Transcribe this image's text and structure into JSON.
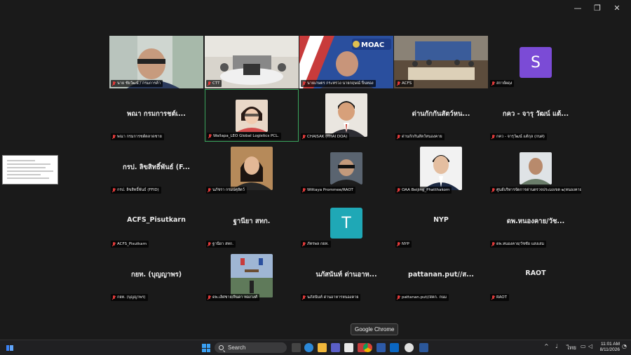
{
  "window": {
    "minimize": "—",
    "restore": "❐",
    "close": "✕"
  },
  "tiles": [
    {
      "id": "t1",
      "type": "video",
      "label": "นาย ชัยวัฒน์ / กรมการค้า"
    },
    {
      "id": "t2",
      "type": "video",
      "label": "CTT"
    },
    {
      "id": "t3",
      "type": "video",
      "label": "นายเกษตร กระทรวง นายกฤษณ์ ปิ่นทอง",
      "logo_text": "MOAC"
    },
    {
      "id": "t4",
      "type": "video",
      "label": "ACFS"
    },
    {
      "id": "t5",
      "type": "avatar",
      "letter": "S",
      "color": "#7b4bd6",
      "label": "สกาย์ผดุง"
    },
    {
      "id": "t6",
      "type": "name",
      "big": "พณา กรมการชต์เ...",
      "label": "พณา กรมการชต์ตลาดชาย"
    },
    {
      "id": "t7",
      "type": "photo",
      "label": "Wallapa_LEO Global Logistics PCL.",
      "active": true
    },
    {
      "id": "t8",
      "type": "photo",
      "label": "CHAISAK (THAI DOA)"
    },
    {
      "id": "t9",
      "type": "name",
      "big": "ด่านกักกันสัตว์หน...",
      "label": "ด่านกักกันสัตว์หนองคาย"
    },
    {
      "id": "t10",
      "type": "name",
      "big": "กคว - จารุ วัฒน์ แต้...",
      "label": "กคว - จารุวัฒน์ แต้กุล (กนศ)"
    },
    {
      "id": "t11",
      "type": "name",
      "big": "กรป. ลิขสิทธิ์พันธ์ (F...",
      "label": "กรป. ลิขสิทธิ์พันธ์ (FFID)"
    },
    {
      "id": "t12",
      "type": "photo",
      "label": "นภัชรา กรมปศุสัตว์"
    },
    {
      "id": "t13",
      "type": "photo",
      "label": "Wittaya Prommee/RAOT"
    },
    {
      "id": "t14",
      "type": "photo",
      "label": "OAA Beijing_Phatthakorn"
    },
    {
      "id": "t15",
      "type": "photo",
      "label": "ศูนย์บริหารจัดการด่านตรวจประมงเขต ๒(หนองคาย)..."
    },
    {
      "id": "t16",
      "type": "name",
      "big": "ACFS_Pisutkarn",
      "label": "ACFS_Pisutkarn"
    },
    {
      "id": "t17",
      "type": "name",
      "big": "ฐานียา สทก.",
      "label": "ฐานียา สทก."
    },
    {
      "id": "t18",
      "type": "avatar",
      "letter": "T",
      "color": "#1fa8b6",
      "label": "ภัทรพล กยท."
    },
    {
      "id": "t19",
      "type": "name",
      "big": "NYP",
      "label": "NYP"
    },
    {
      "id": "t20",
      "type": "name",
      "big": "ดพ.หนองคาย/วัช...",
      "label": "ดพ.หนองคาย/วัชชัย แสงเสม"
    },
    {
      "id": "t21",
      "type": "name",
      "big": "กยท. (บุญญาพร)",
      "label": "กยท. (บุญญาพร)"
    },
    {
      "id": "t22",
      "type": "photo",
      "label": "ดพ.เลิศชาย/ลินดา ทองวงศ์"
    },
    {
      "id": "t23",
      "type": "name",
      "big": "นภัสนันท์ ด่านอาห...",
      "label": "นภัสนันท์ ด่านอาหารหนองคาย"
    },
    {
      "id": "t24",
      "type": "name",
      "big": "pattanan.put//ส...",
      "label": "pattanan.put//สคก. กนม"
    },
    {
      "id": "t25",
      "type": "name",
      "big": "RAOT",
      "label": "RAOT"
    }
  ],
  "tooltip": "Google Chrome",
  "taskbar": {
    "search_label": "Search",
    "lang": "ไทย",
    "time": "11:01 AM",
    "date": "8/11/2026"
  }
}
